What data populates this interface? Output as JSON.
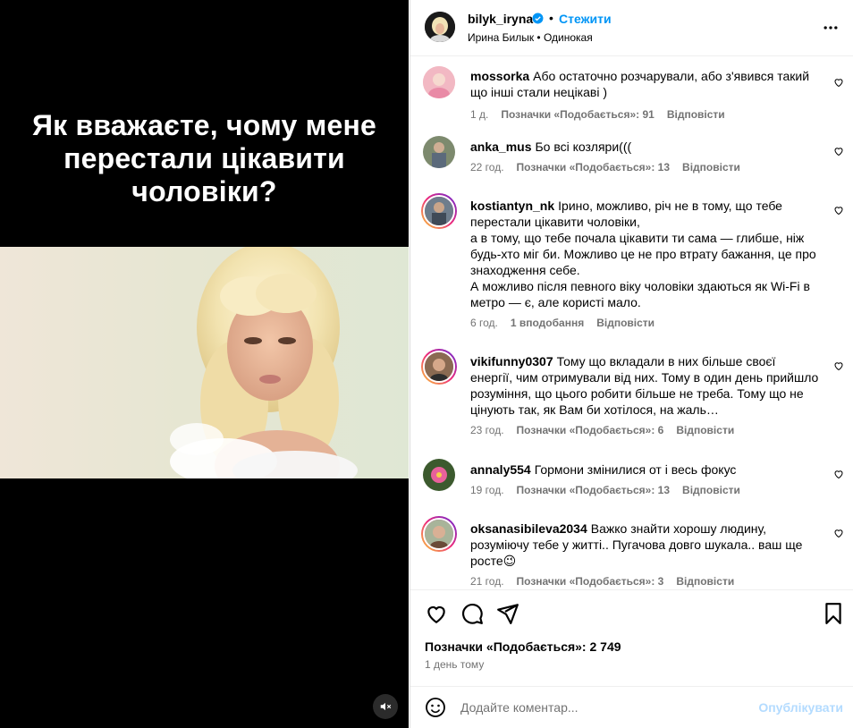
{
  "post": {
    "caption_lines": [
      "Як вважаєте, чому мене",
      "перестали цікавити",
      "чоловіки?"
    ],
    "mute_icon": "mute-icon"
  },
  "header": {
    "username": "bilyk_iryna",
    "separator": "•",
    "follow_label": "Стежити",
    "subtitle": "Ирина Билык • Одинокая",
    "verified_color": "#0095f6"
  },
  "comments": [
    {
      "user": "mossorka",
      "text": "Або остаточно розчарували, або з'явився такий що інші стали нецікаві )",
      "time": "1 д.",
      "likes": "Позначки «Подобається»: 91",
      "reply": "Відповісти"
    },
    {
      "user": "anka_mus",
      "text": "Бо всі козляри(((",
      "time": "22 год.",
      "likes": "Позначки «Подобається»: 13",
      "reply": "Відповісти"
    },
    {
      "user": "kostiantyn_nk",
      "text": "Ірино, можливо, річ не в тому, що тебе перестали цікавити чоловіки,",
      "text2": "а в тому, що тебе почала цікавити ти сама — глибше, ніж будь-хто міг би. Можливо це не про втрату бажання, це про знаходження себе.",
      "text3": "А можливо після певного віку чоловіки здаються як Wi-Fi в метро — є, але користі мало.",
      "time": "6 год.",
      "likes": "1 вподобання",
      "reply": "Відповісти"
    },
    {
      "user": "vikifunny0307",
      "text": "Тому що вкладали в них більше своєї енергії, чим отримували від них. Тому в один день прийшло розуміння, що цього робити більше не треба. Тому що не цінують так, як Вам би хотілося, на жаль…",
      "time": "23 год.",
      "likes": "Позначки «Подобається»: 6",
      "reply": "Відповісти"
    },
    {
      "user": "annaly554",
      "text": "Гормони змінилися от і весь фокус",
      "time": "19 год.",
      "likes": "Позначки «Подобається»: 13",
      "reply": "Відповісти"
    },
    {
      "user": "oksanasibileva2034",
      "text": "Важко знайти хорошу людину, розуміючу тебе у житті.. Пугачова довго шукала.. ваш ще росте😉",
      "time": "21 год.",
      "likes": "Позначки «Подобається»: 3",
      "reply": "Відповісти"
    }
  ],
  "footer": {
    "likes": "Позначки «Подобається»: 2 749",
    "time": "1 день тому",
    "comment_placeholder": "Додайте коментар...",
    "publish_label": "Опублікувати",
    "publish_color": "#b3dbff"
  },
  "icons": [
    "heart-icon",
    "comment-icon",
    "share-icon",
    "bookmark-icon",
    "emoji-icon",
    "more-icon",
    "verified-icon"
  ]
}
